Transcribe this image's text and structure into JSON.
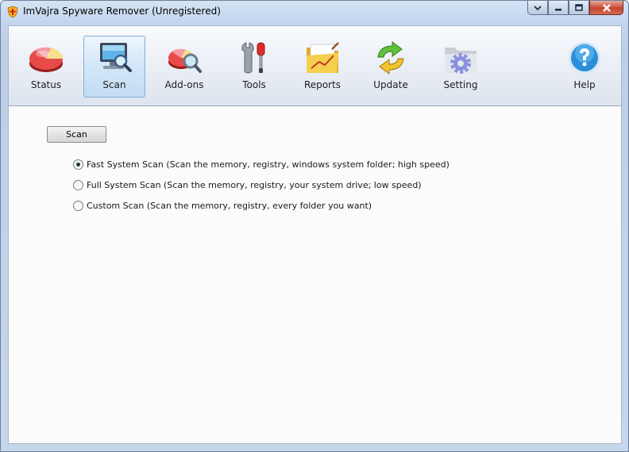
{
  "window": {
    "title": "ImVajra Spyware Remover (Unregistered)"
  },
  "toolbar": {
    "items": [
      {
        "label": "Status",
        "icon": "pie-chart-icon"
      },
      {
        "label": "Scan",
        "icon": "monitor-magnifier-icon",
        "active": true
      },
      {
        "label": "Add-ons",
        "icon": "addons-magnifier-icon"
      },
      {
        "label": "Tools",
        "icon": "tools-icon"
      },
      {
        "label": "Reports",
        "icon": "folder-chart-icon"
      },
      {
        "label": "Update",
        "icon": "refresh-arrows-icon"
      },
      {
        "label": "Setting",
        "icon": "gear-folder-icon"
      },
      {
        "label": "Help",
        "icon": "help-icon"
      }
    ]
  },
  "scan": {
    "button_label": "Scan",
    "options": [
      {
        "label": "Fast System Scan (Scan the memory, registry, windows system folder; high speed)",
        "selected": true
      },
      {
        "label": "Full System Scan (Scan the memory, registry, your system drive; low speed)",
        "selected": false
      },
      {
        "label": "Custom Scan (Scan the memory, registry, every folder you want)",
        "selected": false
      }
    ]
  },
  "colors": {
    "accent": "#86add6",
    "close_button": "#c7442e"
  }
}
